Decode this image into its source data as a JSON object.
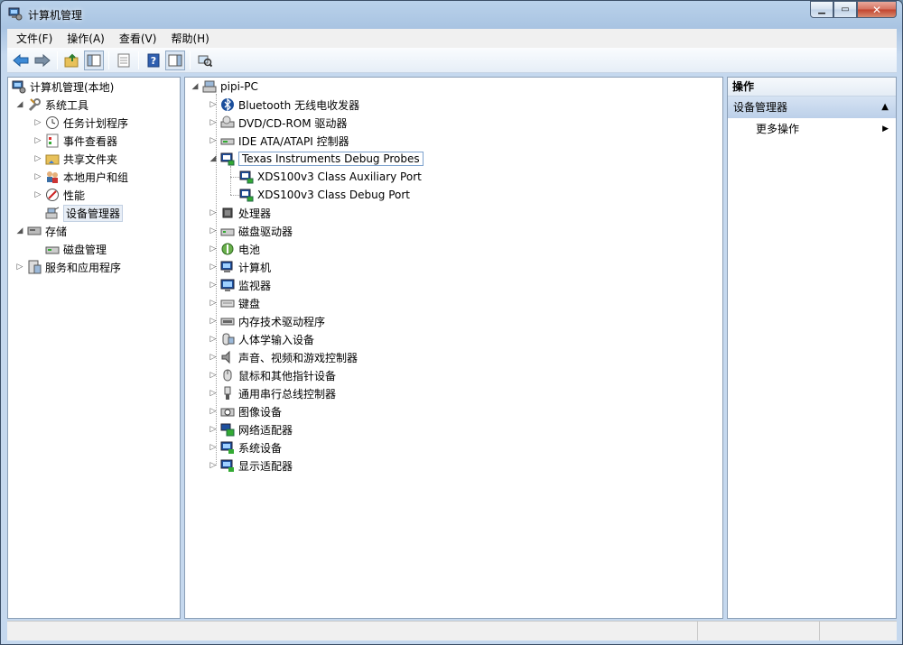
{
  "window": {
    "title": "计算机管理",
    "title_icon": "computer-management-icon"
  },
  "menu": [
    "文件(F)",
    "操作(A)",
    "查看(V)",
    "帮助(H)"
  ],
  "toolbar": {
    "icons": [
      "back-arrow-icon",
      "forward-arrow-icon",
      "up-folder-icon",
      "show-hide-console-tree-icon",
      "properties-icon",
      "help-icon",
      "show-hide-action-pane-icon",
      "scan-hardware-icon"
    ]
  },
  "left_tree": {
    "root": "计算机管理(本地)",
    "system_tools": "系统工具",
    "task_scheduler": "任务计划程序",
    "event_viewer": "事件查看器",
    "shared_folders": "共享文件夹",
    "local_users": "本地用户和组",
    "performance": "性能",
    "device_manager": "设备管理器",
    "storage": "存储",
    "disk_management": "磁盘管理",
    "services_apps": "服务和应用程序"
  },
  "device_tree": {
    "root": "pipi-PC",
    "categories": [
      {
        "label": "Bluetooth 无线电收发器",
        "icon": "bluetooth-icon"
      },
      {
        "label": "DVD/CD-ROM 驱动器",
        "icon": "dvd-drive-icon"
      },
      {
        "label": "IDE ATA/ATAPI 控制器",
        "icon": "ide-controller-icon"
      },
      {
        "label": "Texas Instruments Debug Probes",
        "icon": "debug-probe-icon"
      },
      {
        "label": "处理器",
        "icon": "processor-icon"
      },
      {
        "label": "磁盘驱动器",
        "icon": "disk-drive-icon"
      },
      {
        "label": "电池",
        "icon": "battery-icon"
      },
      {
        "label": "计算机",
        "icon": "computer-icon"
      },
      {
        "label": "监视器",
        "icon": "monitor-icon"
      },
      {
        "label": "键盘",
        "icon": "keyboard-icon"
      },
      {
        "label": "内存技术驱动程序",
        "icon": "memory-driver-icon"
      },
      {
        "label": "人体学输入设备",
        "icon": "hid-icon"
      },
      {
        "label": "声音、视频和游戏控制器",
        "icon": "sound-icon"
      },
      {
        "label": "鼠标和其他指针设备",
        "icon": "mouse-icon"
      },
      {
        "label": "通用串行总线控制器",
        "icon": "usb-icon"
      },
      {
        "label": "图像设备",
        "icon": "imaging-device-icon"
      },
      {
        "label": "网络适配器",
        "icon": "network-adapter-icon"
      },
      {
        "label": "系统设备",
        "icon": "system-device-icon"
      },
      {
        "label": "显示适配器",
        "icon": "display-adapter-icon"
      }
    ],
    "ti_children": [
      "XDS100v3 Class Auxiliary Port",
      "XDS100v3 Class Debug Port"
    ]
  },
  "actions": {
    "header": "操作",
    "section": "设备管理器",
    "more": "更多操作"
  }
}
